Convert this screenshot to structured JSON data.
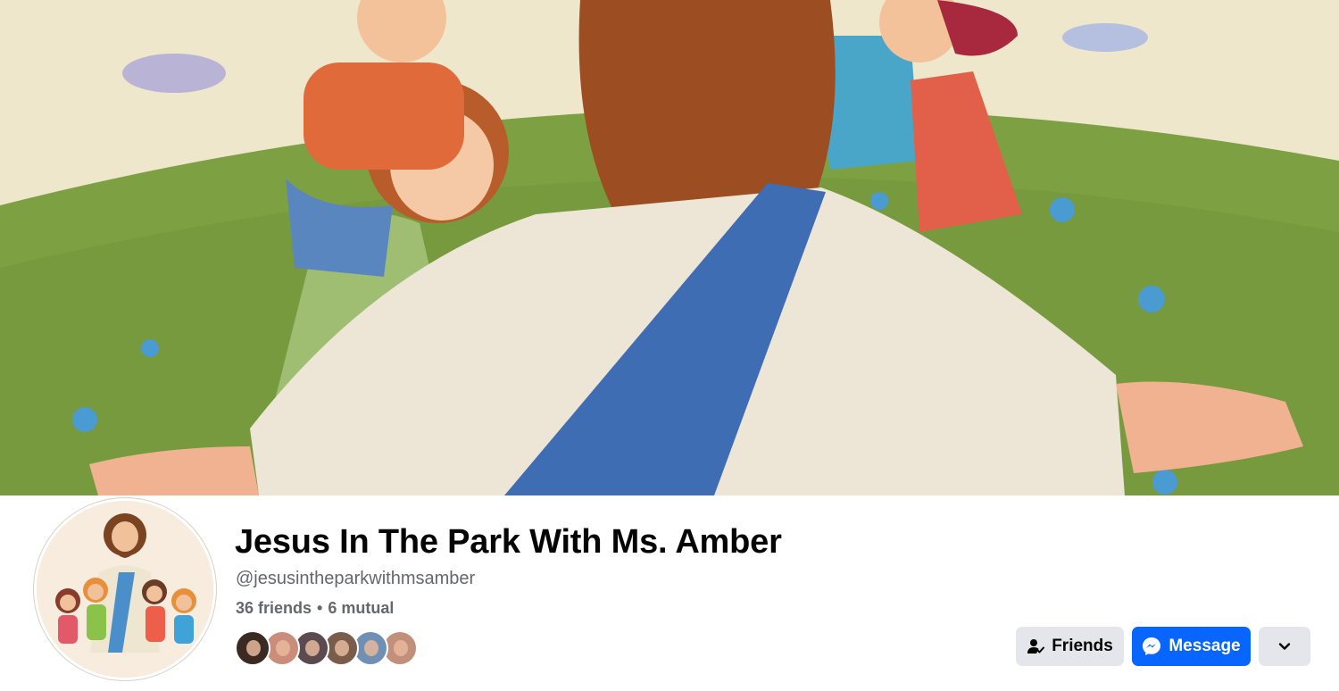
{
  "profile": {
    "name": "Jesus In The Park With Ms. Amber",
    "handle": "@jesusintheparkwithmsamber",
    "friends_count": "36 friends",
    "separator": "•",
    "mutual_count": "6 mutual"
  },
  "actions": {
    "friends_label": "Friends",
    "message_label": "Message"
  },
  "icons": {
    "friends": "person-check-icon",
    "message": "messenger-icon",
    "more": "chevron-down-icon"
  },
  "colors": {
    "primary_button": "#0866ff",
    "secondary_button": "#e4e6eb",
    "name_text": "#050505",
    "secondary_text": "#65676b"
  },
  "mutual_friend_avatars": [
    {
      "color": "#3b2a22"
    },
    {
      "color": "#c98d7a"
    },
    {
      "color": "#5b4a4f"
    },
    {
      "color": "#7a5c4a"
    },
    {
      "color": "#6f8fb4"
    },
    {
      "color": "#c28f7b"
    }
  ]
}
